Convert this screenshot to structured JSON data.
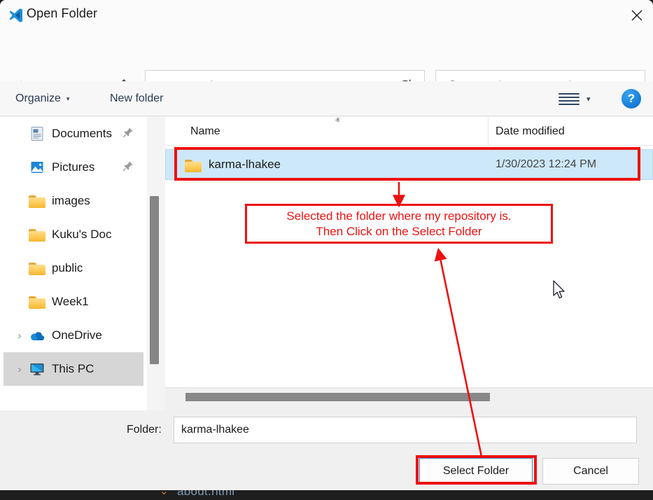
{
  "window": {
    "title": "Open Folder",
    "app_icon": "vscode-icon",
    "close_icon": "close-icon"
  },
  "navbar": {
    "back_icon": "arrow-left-icon",
    "forward_icon": "arrow-right-icon",
    "recent_icon": "chevron-down-icon",
    "up_icon": "arrow-up-icon",
    "refresh_icon": "refresh-icon",
    "breadcrumb": {
      "folder_icon": "folder-icon",
      "overflow": "«",
      "items": [
        {
          "label": "Desk...",
          "separator": "›"
        },
        {
          "label": "Docu...",
          "separator": "›"
        }
      ],
      "dropdown_icon": "chevron-down-icon"
    },
    "search": {
      "icon": "search-icon",
      "placeholder": "Search Documentation",
      "value": ""
    }
  },
  "commandbar": {
    "organize_label": "Organize",
    "organize_caret": "▾",
    "new_folder_label": "New folder",
    "view_mode_icon": "list-view-icon",
    "view_mode_caret": "▾",
    "help_icon": "help-icon",
    "help_label": "?"
  },
  "sidebar": {
    "items": [
      {
        "label": "Documents",
        "icon": "documents-icon",
        "pinned": true,
        "expander": false,
        "selected": false
      },
      {
        "label": "Pictures",
        "icon": "pictures-icon",
        "pinned": true,
        "expander": false,
        "selected": false
      },
      {
        "label": "images",
        "icon": "folder-icon",
        "pinned": false,
        "expander": false,
        "selected": false
      },
      {
        "label": "Kuku's Doc",
        "icon": "folder-icon",
        "pinned": false,
        "expander": false,
        "selected": false
      },
      {
        "label": "public",
        "icon": "folder-icon",
        "pinned": false,
        "expander": false,
        "selected": false
      },
      {
        "label": "Week1",
        "icon": "folder-icon",
        "pinned": false,
        "expander": false,
        "selected": false
      },
      {
        "label": "OneDrive",
        "icon": "onedrive-icon",
        "pinned": false,
        "expander": true,
        "selected": false
      },
      {
        "label": "This PC",
        "icon": "this-pc-icon",
        "pinned": false,
        "expander": true,
        "selected": true
      }
    ],
    "pin_glyph": "📌",
    "expander_glyph": "›"
  },
  "filelist": {
    "columns": [
      {
        "key": "name",
        "label": "Name"
      },
      {
        "key": "date",
        "label": "Date modified"
      }
    ],
    "sort_indicator": "ⱏ",
    "rows": [
      {
        "icon": "folder-icon",
        "name": "karma-lhakee",
        "date": "1/30/2023 12:24 PM",
        "selected": true
      }
    ]
  },
  "footer": {
    "folder_label": "Folder:",
    "folder_value": "karma-lhakee",
    "select_folder_label": "Select Folder",
    "cancel_label": "Cancel"
  },
  "annotations": {
    "note_lines": [
      "Selected the folder where my repository is.",
      "Then Click on the Select Folder"
    ],
    "color": "#ee1111"
  },
  "backdrop": {
    "file_label": "about.html",
    "chevron": "⌄"
  },
  "colors": {
    "annotation_red": "#ee1111",
    "selection_blue": "#cde8f9",
    "accent_blue": "#1277d4",
    "sidebar_selected_gray": "#d6d6d6",
    "scrollbar_gray": "#858585"
  }
}
